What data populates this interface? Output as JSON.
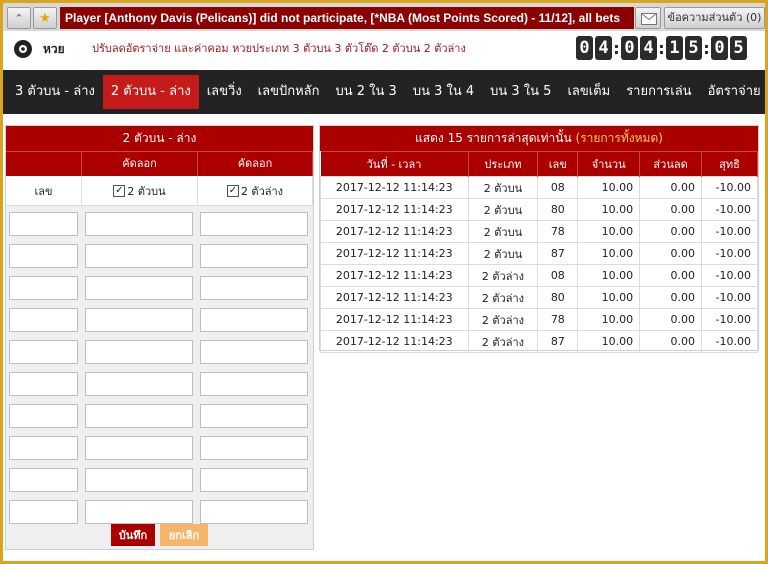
{
  "topbar": {
    "ticker_text": "Player [Anthony Davis (Pelicans)] did not participate, [*NBA (Most Points Scored) - 11/12], all bets",
    "profile_label": "ข้อความส่วนตัว (0)"
  },
  "header": {
    "brand": "หวย",
    "rate_link": "ปรับลดอัตราจ่าย และค่าคอม หวยประเภท 3 ตัวบน 3 ตัวโต๊ด 2 ตัวบน 2 ตัวล่าง",
    "clock": {
      "h": [
        "0",
        "4"
      ],
      "m": [
        "0",
        "4"
      ],
      "s": [
        "1",
        "5"
      ],
      "f": [
        "0",
        "5"
      ]
    }
  },
  "nav": {
    "items": [
      {
        "label": "3 ตัวบน - ล่าง"
      },
      {
        "label": "2 ตัวบน - ล่าง"
      },
      {
        "label": "เลขวิ่ง"
      },
      {
        "label": "เลขปักหลัก"
      },
      {
        "label": "บน 2 ใน 3"
      },
      {
        "label": "บน 3 ใน 4"
      },
      {
        "label": "บน 3 ใน 5"
      },
      {
        "label": "เลขเต็ม"
      },
      {
        "label": "รายการเล่น"
      },
      {
        "label": "อัตราจ่าย"
      }
    ],
    "active_index": 1
  },
  "left_panel": {
    "title": "2 ตัวบน - ล่าง",
    "col2_header": "คัดลอก",
    "col3_header": "คัดลอก",
    "number_label": "เลข",
    "check_top_label": "2 ตัวบน",
    "check_bottom_label": "2 ตัวล่าง",
    "save_label": "บันทึก",
    "cancel_label": "ยกเลิก"
  },
  "right_panel": {
    "title_prefix": "แสดง 15 รายการล่าสุดเท่านั้น",
    "title_link": "(รายการทั้งหมด)",
    "columns": [
      "วันที่ - เวลา",
      "ประเภท",
      "เลข",
      "จำนวน",
      "ส่วนลด",
      "สุทธิ"
    ],
    "rows": [
      [
        "2017-12-12 11:14:23",
        "2 ตัวบน",
        "08",
        "10.00",
        "0.00",
        "-10.00"
      ],
      [
        "2017-12-12 11:14:23",
        "2 ตัวบน",
        "80",
        "10.00",
        "0.00",
        "-10.00"
      ],
      [
        "2017-12-12 11:14:23",
        "2 ตัวบน",
        "78",
        "10.00",
        "0.00",
        "-10.00"
      ],
      [
        "2017-12-12 11:14:23",
        "2 ตัวบน",
        "87",
        "10.00",
        "0.00",
        "-10.00"
      ],
      [
        "2017-12-12 11:14:23",
        "2 ตัวล่าง",
        "08",
        "10.00",
        "0.00",
        "-10.00"
      ],
      [
        "2017-12-12 11:14:23",
        "2 ตัวล่าง",
        "80",
        "10.00",
        "0.00",
        "-10.00"
      ],
      [
        "2017-12-12 11:14:23",
        "2 ตัวล่าง",
        "78",
        "10.00",
        "0.00",
        "-10.00"
      ],
      [
        "2017-12-12 11:14:23",
        "2 ตัวล่าง",
        "87",
        "10.00",
        "0.00",
        "-10.00"
      ]
    ]
  }
}
